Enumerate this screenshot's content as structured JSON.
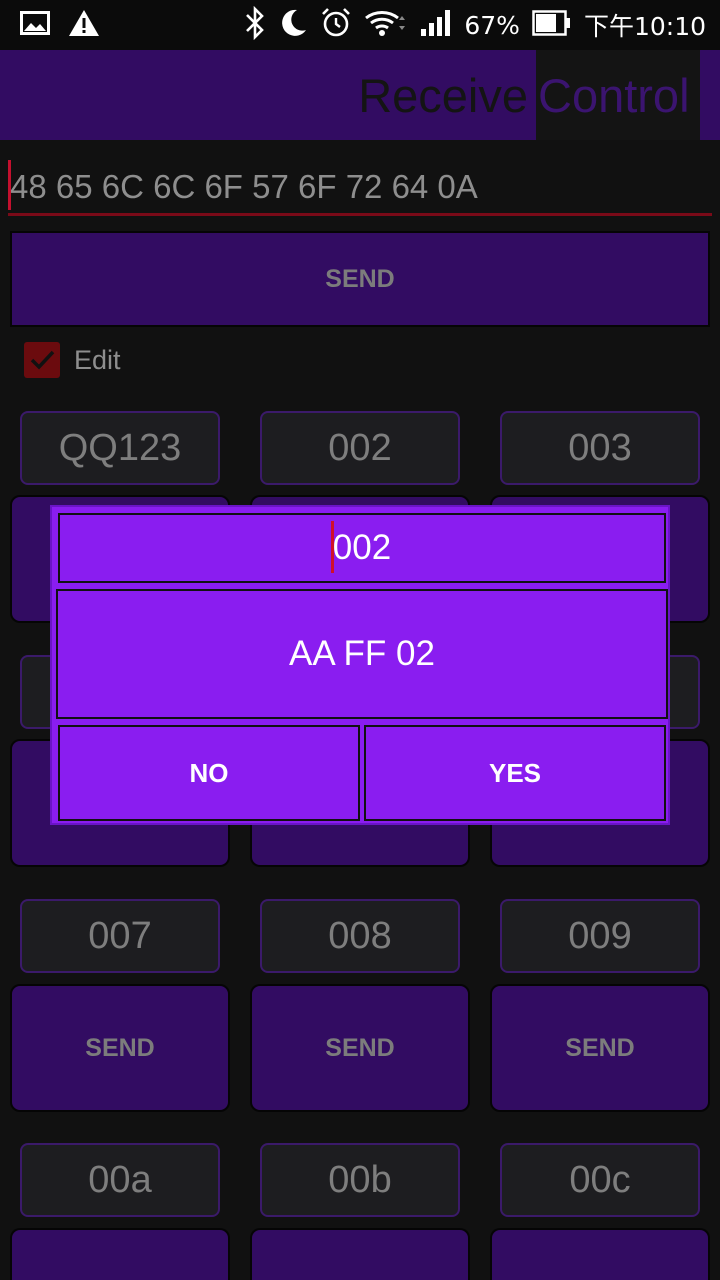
{
  "status_bar": {
    "battery": "67%",
    "time": "下午10:10",
    "icons": [
      "gallery-icon",
      "warning-icon",
      "bluetooth-icon",
      "moon-icon",
      "alarm-icon",
      "wifi-icon",
      "signal-icon",
      "battery-icon"
    ]
  },
  "tabs": [
    {
      "label": "Receive"
    },
    {
      "label": "Control"
    }
  ],
  "input": {
    "value": "48 65 6C 6C 6F 57 6F 72 64 0A"
  },
  "main_send_label": "SEND",
  "edit": {
    "label": "Edit",
    "checked": true
  },
  "grid": {
    "labels": [
      "QQ123",
      "002",
      "003",
      "007",
      "008",
      "009",
      "00a",
      "00b",
      "00c"
    ],
    "send_label": "SEND"
  },
  "dialog": {
    "name_value": "002",
    "data_value": "AA FF 02",
    "no_label": "NO",
    "yes_label": "YES"
  },
  "colors": {
    "primary_dark": "#320c62",
    "dialog_bg": "#8a1df0",
    "accent_red": "#7a0a18"
  }
}
